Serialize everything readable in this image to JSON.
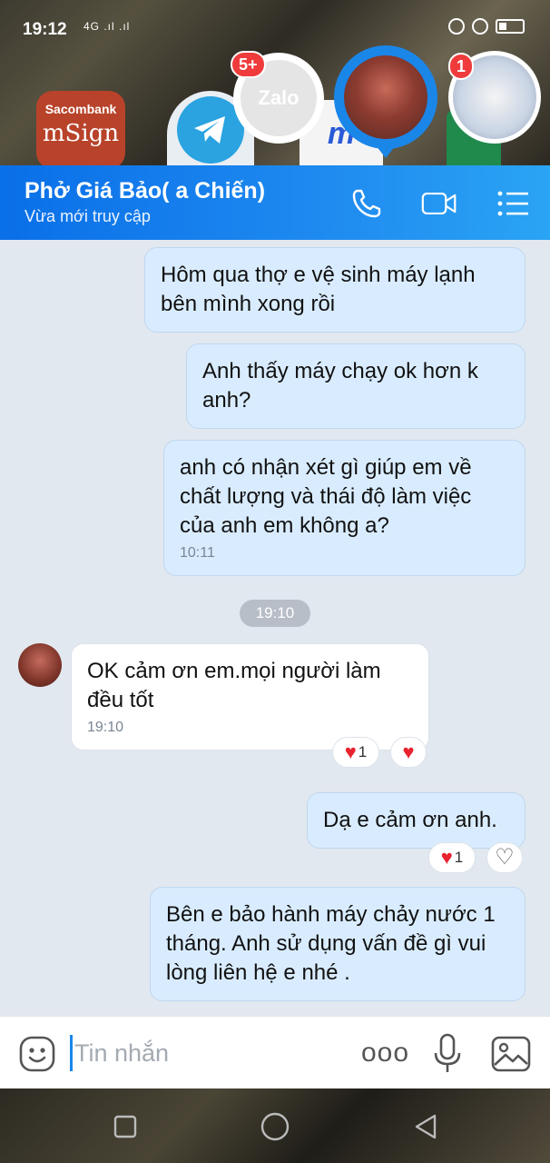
{
  "status_bar": {
    "time": "19:12",
    "signal": "4G .ıl .ıl"
  },
  "home_screen": {
    "apps": [
      {
        "name": "Sacombank mSign",
        "label_top": "Sacombank",
        "label_bottom": "mSign"
      },
      {
        "name": "Telegram"
      },
      {
        "name": "MVN",
        "label": "m"
      },
      {
        "name": "Sheets"
      }
    ]
  },
  "chat_heads": {
    "zalo": {
      "label": "Zalo",
      "badge": "5+"
    },
    "family": {
      "badge": "1"
    }
  },
  "chat_header": {
    "title": "Phở Giá Bảo( a Chiến)",
    "subtitle": "Vừa mới truy cập"
  },
  "conversation": {
    "messages": [
      {
        "direction": "out",
        "text": "Hôm qua thợ e vệ sinh máy lạnh bên mình xong rồi"
      },
      {
        "direction": "out",
        "text": "Anh thấy máy chạy ok hơn k anh?"
      },
      {
        "direction": "out",
        "text": "anh có nhận xét gì giúp em về chất lượng và thái độ làm việc của anh em không a?",
        "time": "10:11"
      },
      {
        "direction": "in",
        "text": "OK cảm ơn em.mọi người làm đều tốt",
        "time": "19:10",
        "reaction_count": "1"
      },
      {
        "direction": "out",
        "text": "Dạ e cảm ơn anh.",
        "reaction_count": "1"
      },
      {
        "direction": "out",
        "text": "Bên e bảo hành máy chảy nước 1 tháng. Anh sử dụng vấn đề gì vui lòng liên hệ e nhé ."
      }
    ],
    "day_separator": "19:10"
  },
  "input_bar": {
    "placeholder": "Tin nhắn",
    "more_label": "ooo"
  },
  "colors": {
    "header_blue": "#1a86e8",
    "outgoing_bubble": "#d9ecff",
    "incoming_bubble": "#ffffff",
    "heart": "#e8232f"
  }
}
